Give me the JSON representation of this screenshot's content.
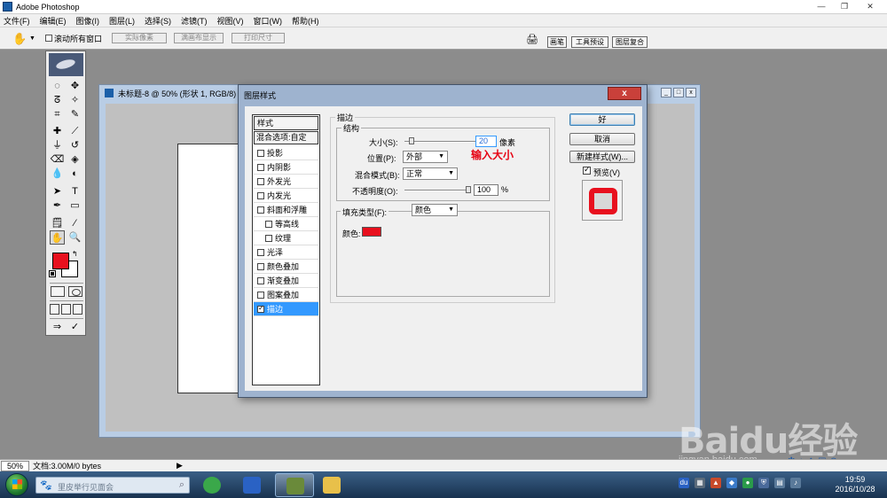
{
  "app": {
    "title": "Adobe Photoshop"
  },
  "menu": [
    "文件(F)",
    "编辑(E)",
    "图像(I)",
    "图层(L)",
    "选择(S)",
    "滤镜(T)",
    "视图(V)",
    "窗口(W)",
    "帮助(H)"
  ],
  "options": {
    "scroll_all_label": "滚动所有窗口",
    "actual_pixels": "实际像素",
    "fit_screen": "满画布显示",
    "print_size": "打印尺寸"
  },
  "palette_tabs": [
    "画笔",
    "工具预设",
    "图层复合"
  ],
  "document": {
    "title": "未标题-8 @ 50% (形状 1, RGB/8)"
  },
  "dialog": {
    "title": "图层样式",
    "close": "x",
    "styles_header": "样式",
    "blend_options": "混合选项:自定",
    "style_items": [
      "投影",
      "内阴影",
      "外发光",
      "内发光",
      "斜面和浮雕",
      "等高线",
      "纹理",
      "光泽",
      "颜色叠加",
      "渐变叠加",
      "图案叠加",
      "描边"
    ],
    "selected_item": "描边",
    "section_title": "描边",
    "structure_title": "结构",
    "size_label": "大小(S):",
    "size_value": "20",
    "size_unit": "像素",
    "hint": "输入大小",
    "position_label": "位置(P):",
    "position_value": "外部",
    "blend_mode_label": "混合模式(B):",
    "blend_mode_value": "正常",
    "opacity_label": "不透明度(O):",
    "opacity_value": "100",
    "opacity_unit": "%",
    "fill_type_label": "填充类型(F):",
    "fill_type_value": "颜色",
    "color_label": "颜色:",
    "stroke_color": "#e8101e",
    "ok": "好",
    "cancel": "取消",
    "new_style": "新建样式(W)...",
    "preview_label": "预览(V)"
  },
  "status": {
    "zoom": "50%",
    "doc_info": "文档:3.00M/0 bytes"
  },
  "taskbar": {
    "search_placeholder": "里皮举行见面会",
    "time": "19:59",
    "date": "2016/10/28"
  },
  "watermark": {
    "brand": "Baidu经验",
    "url": "jingyan.baidu.com"
  },
  "colors": {
    "foreground": "#e8101e",
    "background": "#ffffff"
  }
}
